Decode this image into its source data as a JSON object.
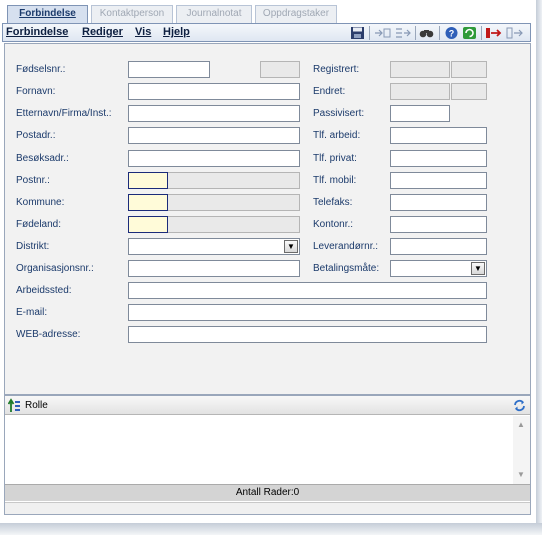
{
  "tabs": [
    {
      "label": "Forbindelse",
      "active": true
    },
    {
      "label": "Kontaktperson",
      "active": false
    },
    {
      "label": "Journalnotat",
      "active": false
    },
    {
      "label": "Oppdragstaker",
      "active": false
    }
  ],
  "menu": {
    "items": [
      "Forbindelse",
      "Rediger",
      "Vis",
      "Hjelp"
    ],
    "toolbar_icons": [
      "save-icon",
      "collapse-icon",
      "expand-icon",
      "find-icon",
      "help-icon",
      "refresh-icon",
      "exit-icon",
      "next-icon"
    ]
  },
  "form": {
    "left_labels": {
      "fodselsnr": "Fødselsnr.:",
      "fornavn": "Fornavn:",
      "etternavn": "Etternavn/Firma/Inst.:",
      "postadr": "Postadr.:",
      "besoksadr": "Besøksadr.:",
      "postnr": "Postnr.:",
      "kommune": "Kommune:",
      "fodeland": "Fødeland:",
      "distrikt": "Distrikt:",
      "organisasjonsnr": "Organisasjonsnr.:",
      "arbeidssted": "Arbeidssted:",
      "email": "E-mail:",
      "web": "WEB-adresse:"
    },
    "right_labels": {
      "registrert": "Registrert:",
      "endret": "Endret:",
      "passivisert": "Passivisert:",
      "tlf_arbeid": "Tlf. arbeid:",
      "tlf_privat": "Tlf. privat:",
      "tlf_mobil": "Tlf. mobil:",
      "telefaks": "Telefaks:",
      "kontonr": "Kontonr.:",
      "leverandornr": "Leverandørnr.:",
      "betalingsmate": "Betalingsmåte:"
    },
    "values": {
      "fodselsnr": "",
      "fornavn": "",
      "etternavn": "",
      "postadr": "",
      "besoksadr": "",
      "postnr": "",
      "kommune": "",
      "fodeland": "",
      "distrikt": "",
      "organisasjonsnr": "",
      "arbeidssted": "",
      "email": "",
      "web": "",
      "registrert": "",
      "endret": "",
      "passivisert": "",
      "tlf_arbeid": "",
      "tlf_privat": "",
      "tlf_mobil": "",
      "telefaks": "",
      "kontonr": "",
      "leverandornr": "",
      "betalingsmate": ""
    }
  },
  "role_list": {
    "column": "Rolle",
    "footer": "Antall Rader:0"
  },
  "colors": {
    "accent": "#1b3a6b",
    "active_tab": "#d6e0ef",
    "readonly": "#e9e9e9",
    "highlight_field": "#fffbd9"
  }
}
